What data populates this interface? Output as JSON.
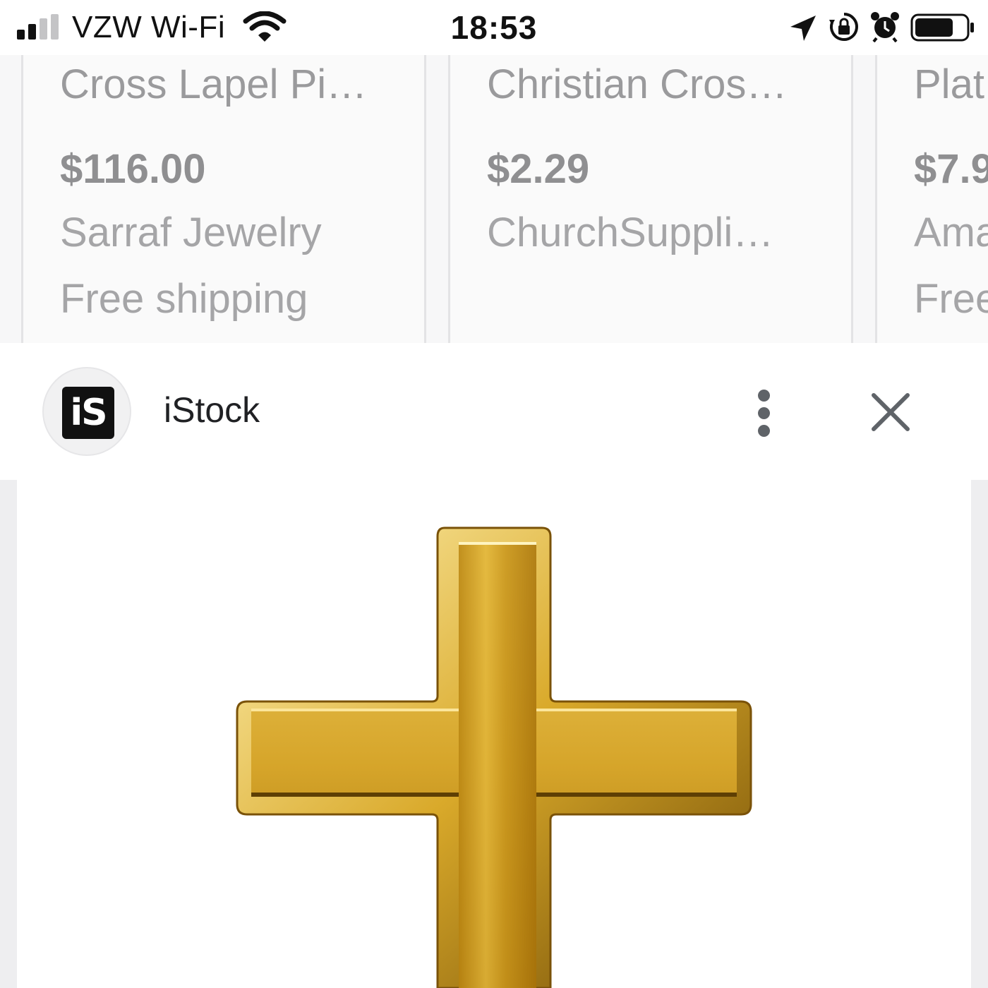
{
  "status_bar": {
    "carrier": "VZW Wi-Fi",
    "time": "18:53",
    "signal_bars_active": 2,
    "signal_bars_total": 4,
    "battery_level": 0.75,
    "icons": [
      "signal-icon",
      "wifi-icon",
      "location-arrow-icon",
      "rotation-lock-icon",
      "alarm-icon",
      "battery-icon"
    ]
  },
  "products": [
    {
      "title": "Cross Lapel Pi…",
      "price": "$116.00",
      "seller": "Sarraf Jewelry",
      "shipping": "Free shipping"
    },
    {
      "title": "Christian Cros…",
      "price": "$2.29",
      "seller": "ChurchSuppli…",
      "shipping": ""
    },
    {
      "title": "Plat",
      "price": "$7.9",
      "seller": "Ama",
      "shipping": "Free"
    }
  ],
  "source": {
    "logo_text": "iS",
    "name": "iStock"
  },
  "colors": {
    "gold": "#d9a92a",
    "icon_gray": "#5f6368",
    "text_dark": "#202124"
  }
}
